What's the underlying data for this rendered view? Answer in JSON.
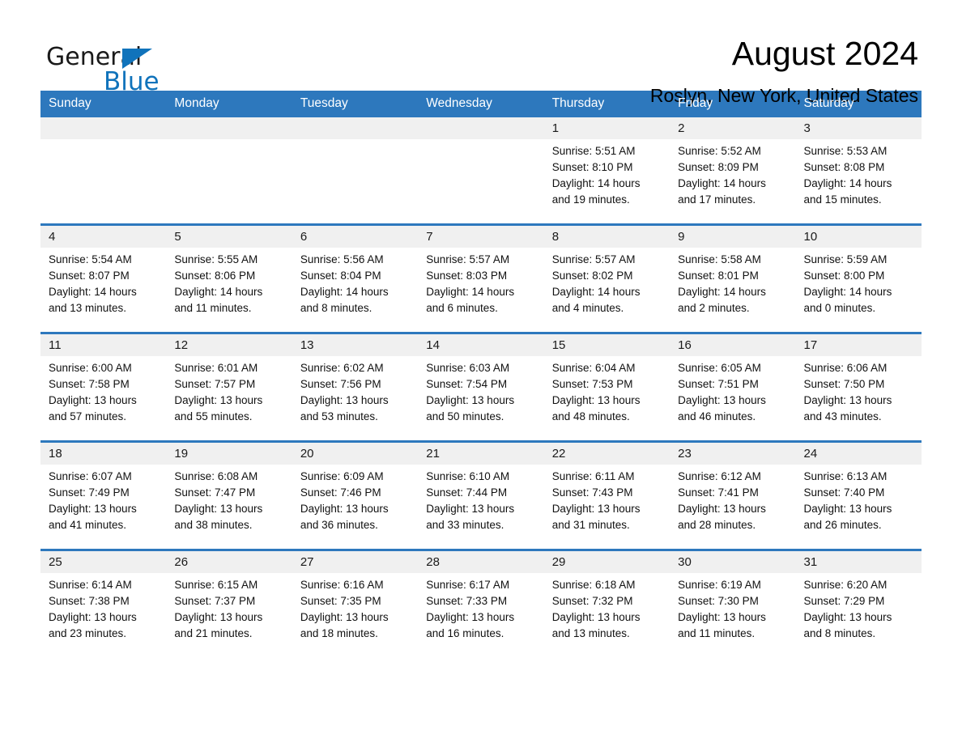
{
  "brand": {
    "name_part1": "General",
    "name_part2": "Blue",
    "logo_color": "#1073bb",
    "icon": "triangle-flag-icon"
  },
  "header": {
    "month_title": "August 2024",
    "location": "Roslyn, New York, United States"
  },
  "theme": {
    "header_blue": "#2d78bd",
    "daynum_band": "#f0f0f0",
    "text": "#111111"
  },
  "calendar": {
    "weekday_headers": [
      "Sunday",
      "Monday",
      "Tuesday",
      "Wednesday",
      "Thursday",
      "Friday",
      "Saturday"
    ],
    "weeks": [
      [
        {
          "day": "",
          "sunrise": "",
          "sunset": "",
          "daylight_line1": "",
          "daylight_line2": "",
          "empty": true
        },
        {
          "day": "",
          "sunrise": "",
          "sunset": "",
          "daylight_line1": "",
          "daylight_line2": "",
          "empty": true
        },
        {
          "day": "",
          "sunrise": "",
          "sunset": "",
          "daylight_line1": "",
          "daylight_line2": "",
          "empty": true
        },
        {
          "day": "",
          "sunrise": "",
          "sunset": "",
          "daylight_line1": "",
          "daylight_line2": "",
          "empty": true
        },
        {
          "day": "1",
          "sunrise": "Sunrise: 5:51 AM",
          "sunset": "Sunset: 8:10 PM",
          "daylight_line1": "Daylight: 14 hours",
          "daylight_line2": "and 19 minutes."
        },
        {
          "day": "2",
          "sunrise": "Sunrise: 5:52 AM",
          "sunset": "Sunset: 8:09 PM",
          "daylight_line1": "Daylight: 14 hours",
          "daylight_line2": "and 17 minutes."
        },
        {
          "day": "3",
          "sunrise": "Sunrise: 5:53 AM",
          "sunset": "Sunset: 8:08 PM",
          "daylight_line1": "Daylight: 14 hours",
          "daylight_line2": "and 15 minutes."
        }
      ],
      [
        {
          "day": "4",
          "sunrise": "Sunrise: 5:54 AM",
          "sunset": "Sunset: 8:07 PM",
          "daylight_line1": "Daylight: 14 hours",
          "daylight_line2": "and 13 minutes."
        },
        {
          "day": "5",
          "sunrise": "Sunrise: 5:55 AM",
          "sunset": "Sunset: 8:06 PM",
          "daylight_line1": "Daylight: 14 hours",
          "daylight_line2": "and 11 minutes."
        },
        {
          "day": "6",
          "sunrise": "Sunrise: 5:56 AM",
          "sunset": "Sunset: 8:04 PM",
          "daylight_line1": "Daylight: 14 hours",
          "daylight_line2": "and 8 minutes."
        },
        {
          "day": "7",
          "sunrise": "Sunrise: 5:57 AM",
          "sunset": "Sunset: 8:03 PM",
          "daylight_line1": "Daylight: 14 hours",
          "daylight_line2": "and 6 minutes."
        },
        {
          "day": "8",
          "sunrise": "Sunrise: 5:57 AM",
          "sunset": "Sunset: 8:02 PM",
          "daylight_line1": "Daylight: 14 hours",
          "daylight_line2": "and 4 minutes."
        },
        {
          "day": "9",
          "sunrise": "Sunrise: 5:58 AM",
          "sunset": "Sunset: 8:01 PM",
          "daylight_line1": "Daylight: 14 hours",
          "daylight_line2": "and 2 minutes."
        },
        {
          "day": "10",
          "sunrise": "Sunrise: 5:59 AM",
          "sunset": "Sunset: 8:00 PM",
          "daylight_line1": "Daylight: 14 hours",
          "daylight_line2": "and 0 minutes."
        }
      ],
      [
        {
          "day": "11",
          "sunrise": "Sunrise: 6:00 AM",
          "sunset": "Sunset: 7:58 PM",
          "daylight_line1": "Daylight: 13 hours",
          "daylight_line2": "and 57 minutes."
        },
        {
          "day": "12",
          "sunrise": "Sunrise: 6:01 AM",
          "sunset": "Sunset: 7:57 PM",
          "daylight_line1": "Daylight: 13 hours",
          "daylight_line2": "and 55 minutes."
        },
        {
          "day": "13",
          "sunrise": "Sunrise: 6:02 AM",
          "sunset": "Sunset: 7:56 PM",
          "daylight_line1": "Daylight: 13 hours",
          "daylight_line2": "and 53 minutes."
        },
        {
          "day": "14",
          "sunrise": "Sunrise: 6:03 AM",
          "sunset": "Sunset: 7:54 PM",
          "daylight_line1": "Daylight: 13 hours",
          "daylight_line2": "and 50 minutes."
        },
        {
          "day": "15",
          "sunrise": "Sunrise: 6:04 AM",
          "sunset": "Sunset: 7:53 PM",
          "daylight_line1": "Daylight: 13 hours",
          "daylight_line2": "and 48 minutes."
        },
        {
          "day": "16",
          "sunrise": "Sunrise: 6:05 AM",
          "sunset": "Sunset: 7:51 PM",
          "daylight_line1": "Daylight: 13 hours",
          "daylight_line2": "and 46 minutes."
        },
        {
          "day": "17",
          "sunrise": "Sunrise: 6:06 AM",
          "sunset": "Sunset: 7:50 PM",
          "daylight_line1": "Daylight: 13 hours",
          "daylight_line2": "and 43 minutes."
        }
      ],
      [
        {
          "day": "18",
          "sunrise": "Sunrise: 6:07 AM",
          "sunset": "Sunset: 7:49 PM",
          "daylight_line1": "Daylight: 13 hours",
          "daylight_line2": "and 41 minutes."
        },
        {
          "day": "19",
          "sunrise": "Sunrise: 6:08 AM",
          "sunset": "Sunset: 7:47 PM",
          "daylight_line1": "Daylight: 13 hours",
          "daylight_line2": "and 38 minutes."
        },
        {
          "day": "20",
          "sunrise": "Sunrise: 6:09 AM",
          "sunset": "Sunset: 7:46 PM",
          "daylight_line1": "Daylight: 13 hours",
          "daylight_line2": "and 36 minutes."
        },
        {
          "day": "21",
          "sunrise": "Sunrise: 6:10 AM",
          "sunset": "Sunset: 7:44 PM",
          "daylight_line1": "Daylight: 13 hours",
          "daylight_line2": "and 33 minutes."
        },
        {
          "day": "22",
          "sunrise": "Sunrise: 6:11 AM",
          "sunset": "Sunset: 7:43 PM",
          "daylight_line1": "Daylight: 13 hours",
          "daylight_line2": "and 31 minutes."
        },
        {
          "day": "23",
          "sunrise": "Sunrise: 6:12 AM",
          "sunset": "Sunset: 7:41 PM",
          "daylight_line1": "Daylight: 13 hours",
          "daylight_line2": "and 28 minutes."
        },
        {
          "day": "24",
          "sunrise": "Sunrise: 6:13 AM",
          "sunset": "Sunset: 7:40 PM",
          "daylight_line1": "Daylight: 13 hours",
          "daylight_line2": "and 26 minutes."
        }
      ],
      [
        {
          "day": "25",
          "sunrise": "Sunrise: 6:14 AM",
          "sunset": "Sunset: 7:38 PM",
          "daylight_line1": "Daylight: 13 hours",
          "daylight_line2": "and 23 minutes."
        },
        {
          "day": "26",
          "sunrise": "Sunrise: 6:15 AM",
          "sunset": "Sunset: 7:37 PM",
          "daylight_line1": "Daylight: 13 hours",
          "daylight_line2": "and 21 minutes."
        },
        {
          "day": "27",
          "sunrise": "Sunrise: 6:16 AM",
          "sunset": "Sunset: 7:35 PM",
          "daylight_line1": "Daylight: 13 hours",
          "daylight_line2": "and 18 minutes."
        },
        {
          "day": "28",
          "sunrise": "Sunrise: 6:17 AM",
          "sunset": "Sunset: 7:33 PM",
          "daylight_line1": "Daylight: 13 hours",
          "daylight_line2": "and 16 minutes."
        },
        {
          "day": "29",
          "sunrise": "Sunrise: 6:18 AM",
          "sunset": "Sunset: 7:32 PM",
          "daylight_line1": "Daylight: 13 hours",
          "daylight_line2": "and 13 minutes."
        },
        {
          "day": "30",
          "sunrise": "Sunrise: 6:19 AM",
          "sunset": "Sunset: 7:30 PM",
          "daylight_line1": "Daylight: 13 hours",
          "daylight_line2": "and 11 minutes."
        },
        {
          "day": "31",
          "sunrise": "Sunrise: 6:20 AM",
          "sunset": "Sunset: 7:29 PM",
          "daylight_line1": "Daylight: 13 hours",
          "daylight_line2": "and 8 minutes."
        }
      ]
    ]
  }
}
